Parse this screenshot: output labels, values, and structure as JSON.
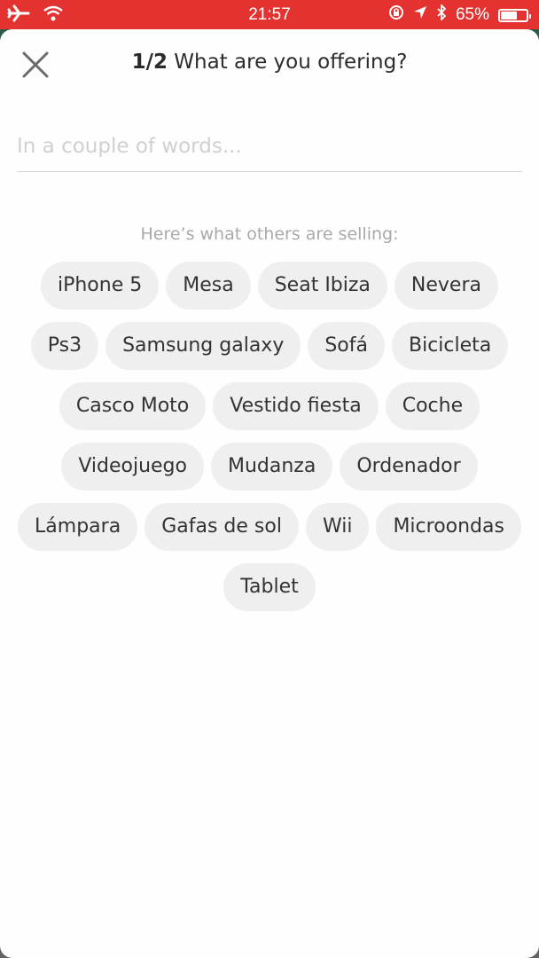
{
  "status_bar": {
    "time": "21:57",
    "battery_percent_label": "65%",
    "battery_level": 0.65,
    "icons": [
      "airplane-mode-icon",
      "wifi-icon",
      "rotation-lock-icon",
      "location-icon",
      "bluetooth-icon",
      "battery-icon"
    ]
  },
  "header": {
    "step": "1/2",
    "title": "What are you offering?",
    "close_icon": "close-icon"
  },
  "search": {
    "placeholder": "In a couple of words...",
    "value": ""
  },
  "suggestions": {
    "heading": "Here’s what others are selling:",
    "chips": [
      "iPhone 5",
      "Mesa",
      "Seat Ibiza",
      "Nevera",
      "Ps3",
      "Samsung galaxy",
      "Sofá",
      "Bicicleta",
      "Casco Moto",
      "Vestido fiesta",
      "Coche",
      "Videojuego",
      "Mudanza",
      "Ordenador",
      "Lámpara",
      "Gafas de sol",
      "Wii",
      "Microondas",
      "Tablet"
    ]
  },
  "colors": {
    "status_bar": "#e3322f",
    "chip_bg": "#efefef",
    "text": "#2b2b2b",
    "hint": "#a9a9a9"
  }
}
